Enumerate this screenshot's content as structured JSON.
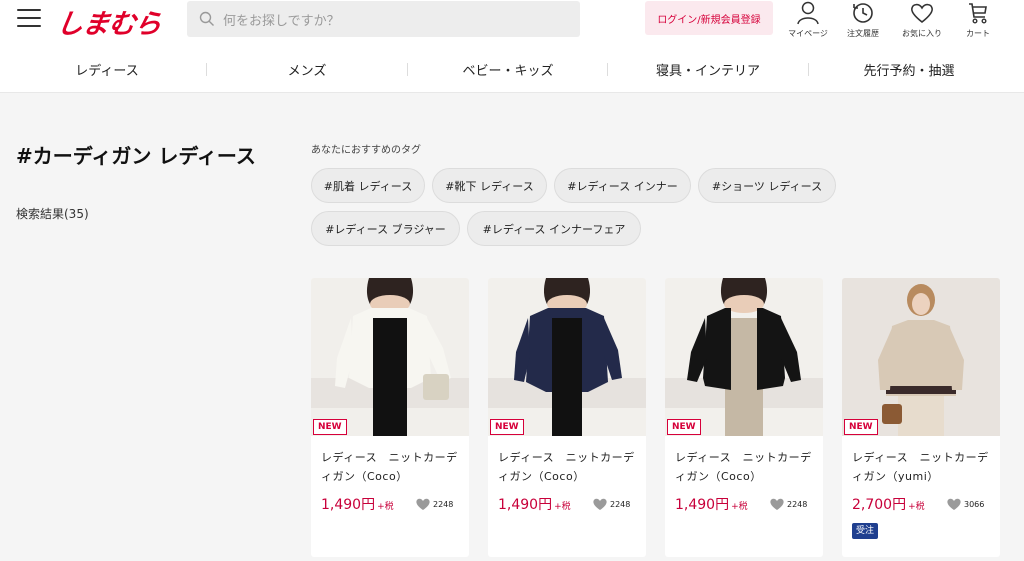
{
  "header": {
    "logo": "しまむら",
    "search_placeholder": "何をお探しですか？",
    "login_label": "ログイン/新規会員登録",
    "icons": [
      {
        "icon": "user-icon",
        "label": "マイページ"
      },
      {
        "icon": "history-icon",
        "label": "注文履歴"
      },
      {
        "icon": "heart-icon",
        "label": "お気に入り"
      },
      {
        "icon": "cart-icon",
        "label": "カート"
      }
    ]
  },
  "nav": {
    "categories": [
      "レディース",
      "メンズ",
      "ベビー・キッズ",
      "寝具・インテリア",
      "先行予約・抽選"
    ]
  },
  "page": {
    "title": "#カーディガン レディース",
    "result_count": "検索結果(35)"
  },
  "tags": {
    "heading": "あなたにおすすめのタグ",
    "items": [
      "#肌着 レディース",
      "#靴下 レディース",
      "#レディース インナー",
      "#ショーツ レディース",
      "#レディース ブラジャー",
      "#レディース インナーフェア"
    ]
  },
  "products": [
    {
      "badge": "NEW",
      "name": "レディース　ニットカーディガン（Coco）",
      "price": "1,490円",
      "tax": "+税",
      "fav_count": "2248",
      "color": "#f4f3ef"
    },
    {
      "badge": "NEW",
      "name": "レディース　ニットカーディガン（Coco）",
      "price": "1,490円",
      "tax": "+税",
      "fav_count": "2248",
      "color": "#232a4a"
    },
    {
      "badge": "NEW",
      "name": "レディース　ニットカーディガン（Coco）",
      "price": "1,490円",
      "tax": "+税",
      "fav_count": "2248",
      "color": "#141414"
    },
    {
      "badge": "NEW",
      "name": "レディース　ニットカーディガン（yumi）",
      "price": "2,700円",
      "tax": "+税",
      "fav_count": "3066",
      "order_badge": "受注",
      "color": "#d8c9b6"
    }
  ],
  "colors": {
    "brand_red": "#e0002a",
    "price_red": "#c8003a",
    "order_badge": "#1f3f8f"
  }
}
